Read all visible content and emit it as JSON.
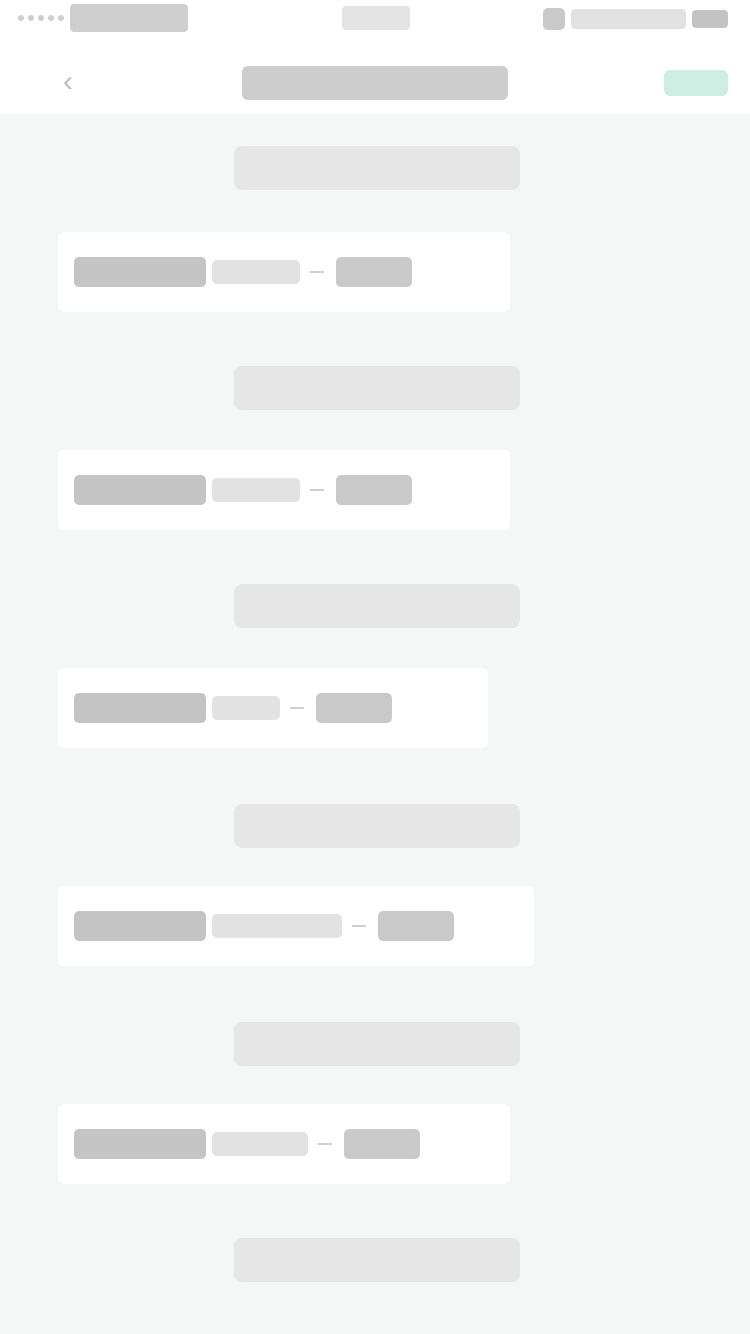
{
  "status_bar": {
    "carrier": "",
    "time": "",
    "battery": ""
  },
  "nav": {
    "back_icon": "back-arrow-icon",
    "title": "",
    "action": ""
  },
  "colors": {
    "background": "#f5f6f6",
    "card": "#ffffff",
    "accent": "#2ec28f"
  },
  "timeline": [
    {
      "time": "",
      "card": {
        "code": "",
        "type": "",
        "amount": ""
      }
    },
    {
      "time": "",
      "card": {
        "code": "",
        "type": "",
        "amount": ""
      }
    },
    {
      "time": "",
      "card": {
        "code": "",
        "type": "",
        "amount": ""
      }
    },
    {
      "time": "",
      "card": {
        "code": "",
        "type": "",
        "amount": ""
      }
    },
    {
      "time": "",
      "card": {
        "code": "",
        "type": "",
        "amount": ""
      }
    }
  ],
  "footer_time": ""
}
